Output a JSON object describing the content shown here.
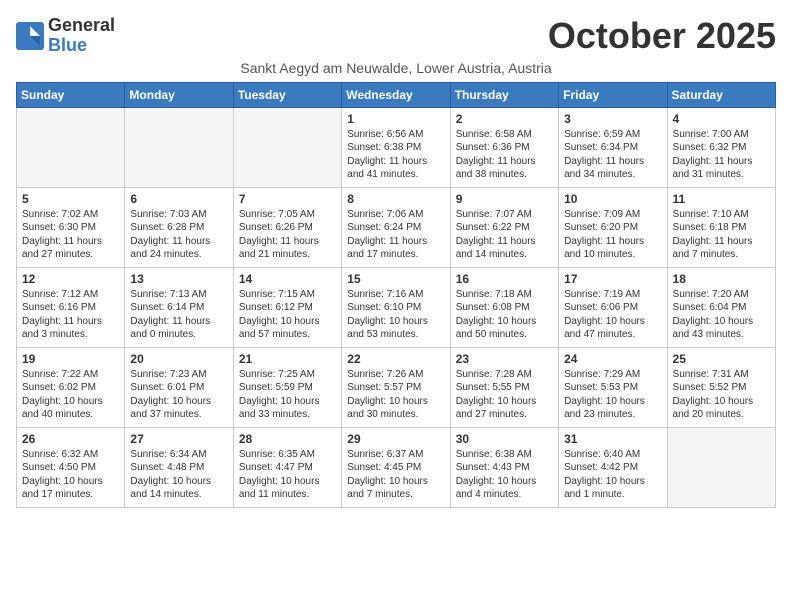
{
  "logo": {
    "general": "General",
    "blue": "Blue"
  },
  "title": "October 2025",
  "subtitle": "Sankt Aegyd am Neuwalde, Lower Austria, Austria",
  "weekdays": [
    "Sunday",
    "Monday",
    "Tuesday",
    "Wednesday",
    "Thursday",
    "Friday",
    "Saturday"
  ],
  "weeks": [
    [
      {
        "day": "",
        "info": ""
      },
      {
        "day": "",
        "info": ""
      },
      {
        "day": "",
        "info": ""
      },
      {
        "day": "1",
        "info": "Sunrise: 6:56 AM\nSunset: 6:38 PM\nDaylight: 11 hours\nand 41 minutes."
      },
      {
        "day": "2",
        "info": "Sunrise: 6:58 AM\nSunset: 6:36 PM\nDaylight: 11 hours\nand 38 minutes."
      },
      {
        "day": "3",
        "info": "Sunrise: 6:59 AM\nSunset: 6:34 PM\nDaylight: 11 hours\nand 34 minutes."
      },
      {
        "day": "4",
        "info": "Sunrise: 7:00 AM\nSunset: 6:32 PM\nDaylight: 11 hours\nand 31 minutes."
      }
    ],
    [
      {
        "day": "5",
        "info": "Sunrise: 7:02 AM\nSunset: 6:30 PM\nDaylight: 11 hours\nand 27 minutes."
      },
      {
        "day": "6",
        "info": "Sunrise: 7:03 AM\nSunset: 6:28 PM\nDaylight: 11 hours\nand 24 minutes."
      },
      {
        "day": "7",
        "info": "Sunrise: 7:05 AM\nSunset: 6:26 PM\nDaylight: 11 hours\nand 21 minutes."
      },
      {
        "day": "8",
        "info": "Sunrise: 7:06 AM\nSunset: 6:24 PM\nDaylight: 11 hours\nand 17 minutes."
      },
      {
        "day": "9",
        "info": "Sunrise: 7:07 AM\nSunset: 6:22 PM\nDaylight: 11 hours\nand 14 minutes."
      },
      {
        "day": "10",
        "info": "Sunrise: 7:09 AM\nSunset: 6:20 PM\nDaylight: 11 hours\nand 10 minutes."
      },
      {
        "day": "11",
        "info": "Sunrise: 7:10 AM\nSunset: 6:18 PM\nDaylight: 11 hours\nand 7 minutes."
      }
    ],
    [
      {
        "day": "12",
        "info": "Sunrise: 7:12 AM\nSunset: 6:16 PM\nDaylight: 11 hours\nand 3 minutes."
      },
      {
        "day": "13",
        "info": "Sunrise: 7:13 AM\nSunset: 6:14 PM\nDaylight: 11 hours\nand 0 minutes."
      },
      {
        "day": "14",
        "info": "Sunrise: 7:15 AM\nSunset: 6:12 PM\nDaylight: 10 hours\nand 57 minutes."
      },
      {
        "day": "15",
        "info": "Sunrise: 7:16 AM\nSunset: 6:10 PM\nDaylight: 10 hours\nand 53 minutes."
      },
      {
        "day": "16",
        "info": "Sunrise: 7:18 AM\nSunset: 6:08 PM\nDaylight: 10 hours\nand 50 minutes."
      },
      {
        "day": "17",
        "info": "Sunrise: 7:19 AM\nSunset: 6:06 PM\nDaylight: 10 hours\nand 47 minutes."
      },
      {
        "day": "18",
        "info": "Sunrise: 7:20 AM\nSunset: 6:04 PM\nDaylight: 10 hours\nand 43 minutes."
      }
    ],
    [
      {
        "day": "19",
        "info": "Sunrise: 7:22 AM\nSunset: 6:02 PM\nDaylight: 10 hours\nand 40 minutes."
      },
      {
        "day": "20",
        "info": "Sunrise: 7:23 AM\nSunset: 6:01 PM\nDaylight: 10 hours\nand 37 minutes."
      },
      {
        "day": "21",
        "info": "Sunrise: 7:25 AM\nSunset: 5:59 PM\nDaylight: 10 hours\nand 33 minutes."
      },
      {
        "day": "22",
        "info": "Sunrise: 7:26 AM\nSunset: 5:57 PM\nDaylight: 10 hours\nand 30 minutes."
      },
      {
        "day": "23",
        "info": "Sunrise: 7:28 AM\nSunset: 5:55 PM\nDaylight: 10 hours\nand 27 minutes."
      },
      {
        "day": "24",
        "info": "Sunrise: 7:29 AM\nSunset: 5:53 PM\nDaylight: 10 hours\nand 23 minutes."
      },
      {
        "day": "25",
        "info": "Sunrise: 7:31 AM\nSunset: 5:52 PM\nDaylight: 10 hours\nand 20 minutes."
      }
    ],
    [
      {
        "day": "26",
        "info": "Sunrise: 6:32 AM\nSunset: 4:50 PM\nDaylight: 10 hours\nand 17 minutes."
      },
      {
        "day": "27",
        "info": "Sunrise: 6:34 AM\nSunset: 4:48 PM\nDaylight: 10 hours\nand 14 minutes."
      },
      {
        "day": "28",
        "info": "Sunrise: 6:35 AM\nSunset: 4:47 PM\nDaylight: 10 hours\nand 11 minutes."
      },
      {
        "day": "29",
        "info": "Sunrise: 6:37 AM\nSunset: 4:45 PM\nDaylight: 10 hours\nand 7 minutes."
      },
      {
        "day": "30",
        "info": "Sunrise: 6:38 AM\nSunset: 4:43 PM\nDaylight: 10 hours\nand 4 minutes."
      },
      {
        "day": "31",
        "info": "Sunrise: 6:40 AM\nSunset: 4:42 PM\nDaylight: 10 hours\nand 1 minute."
      },
      {
        "day": "",
        "info": ""
      }
    ]
  ]
}
